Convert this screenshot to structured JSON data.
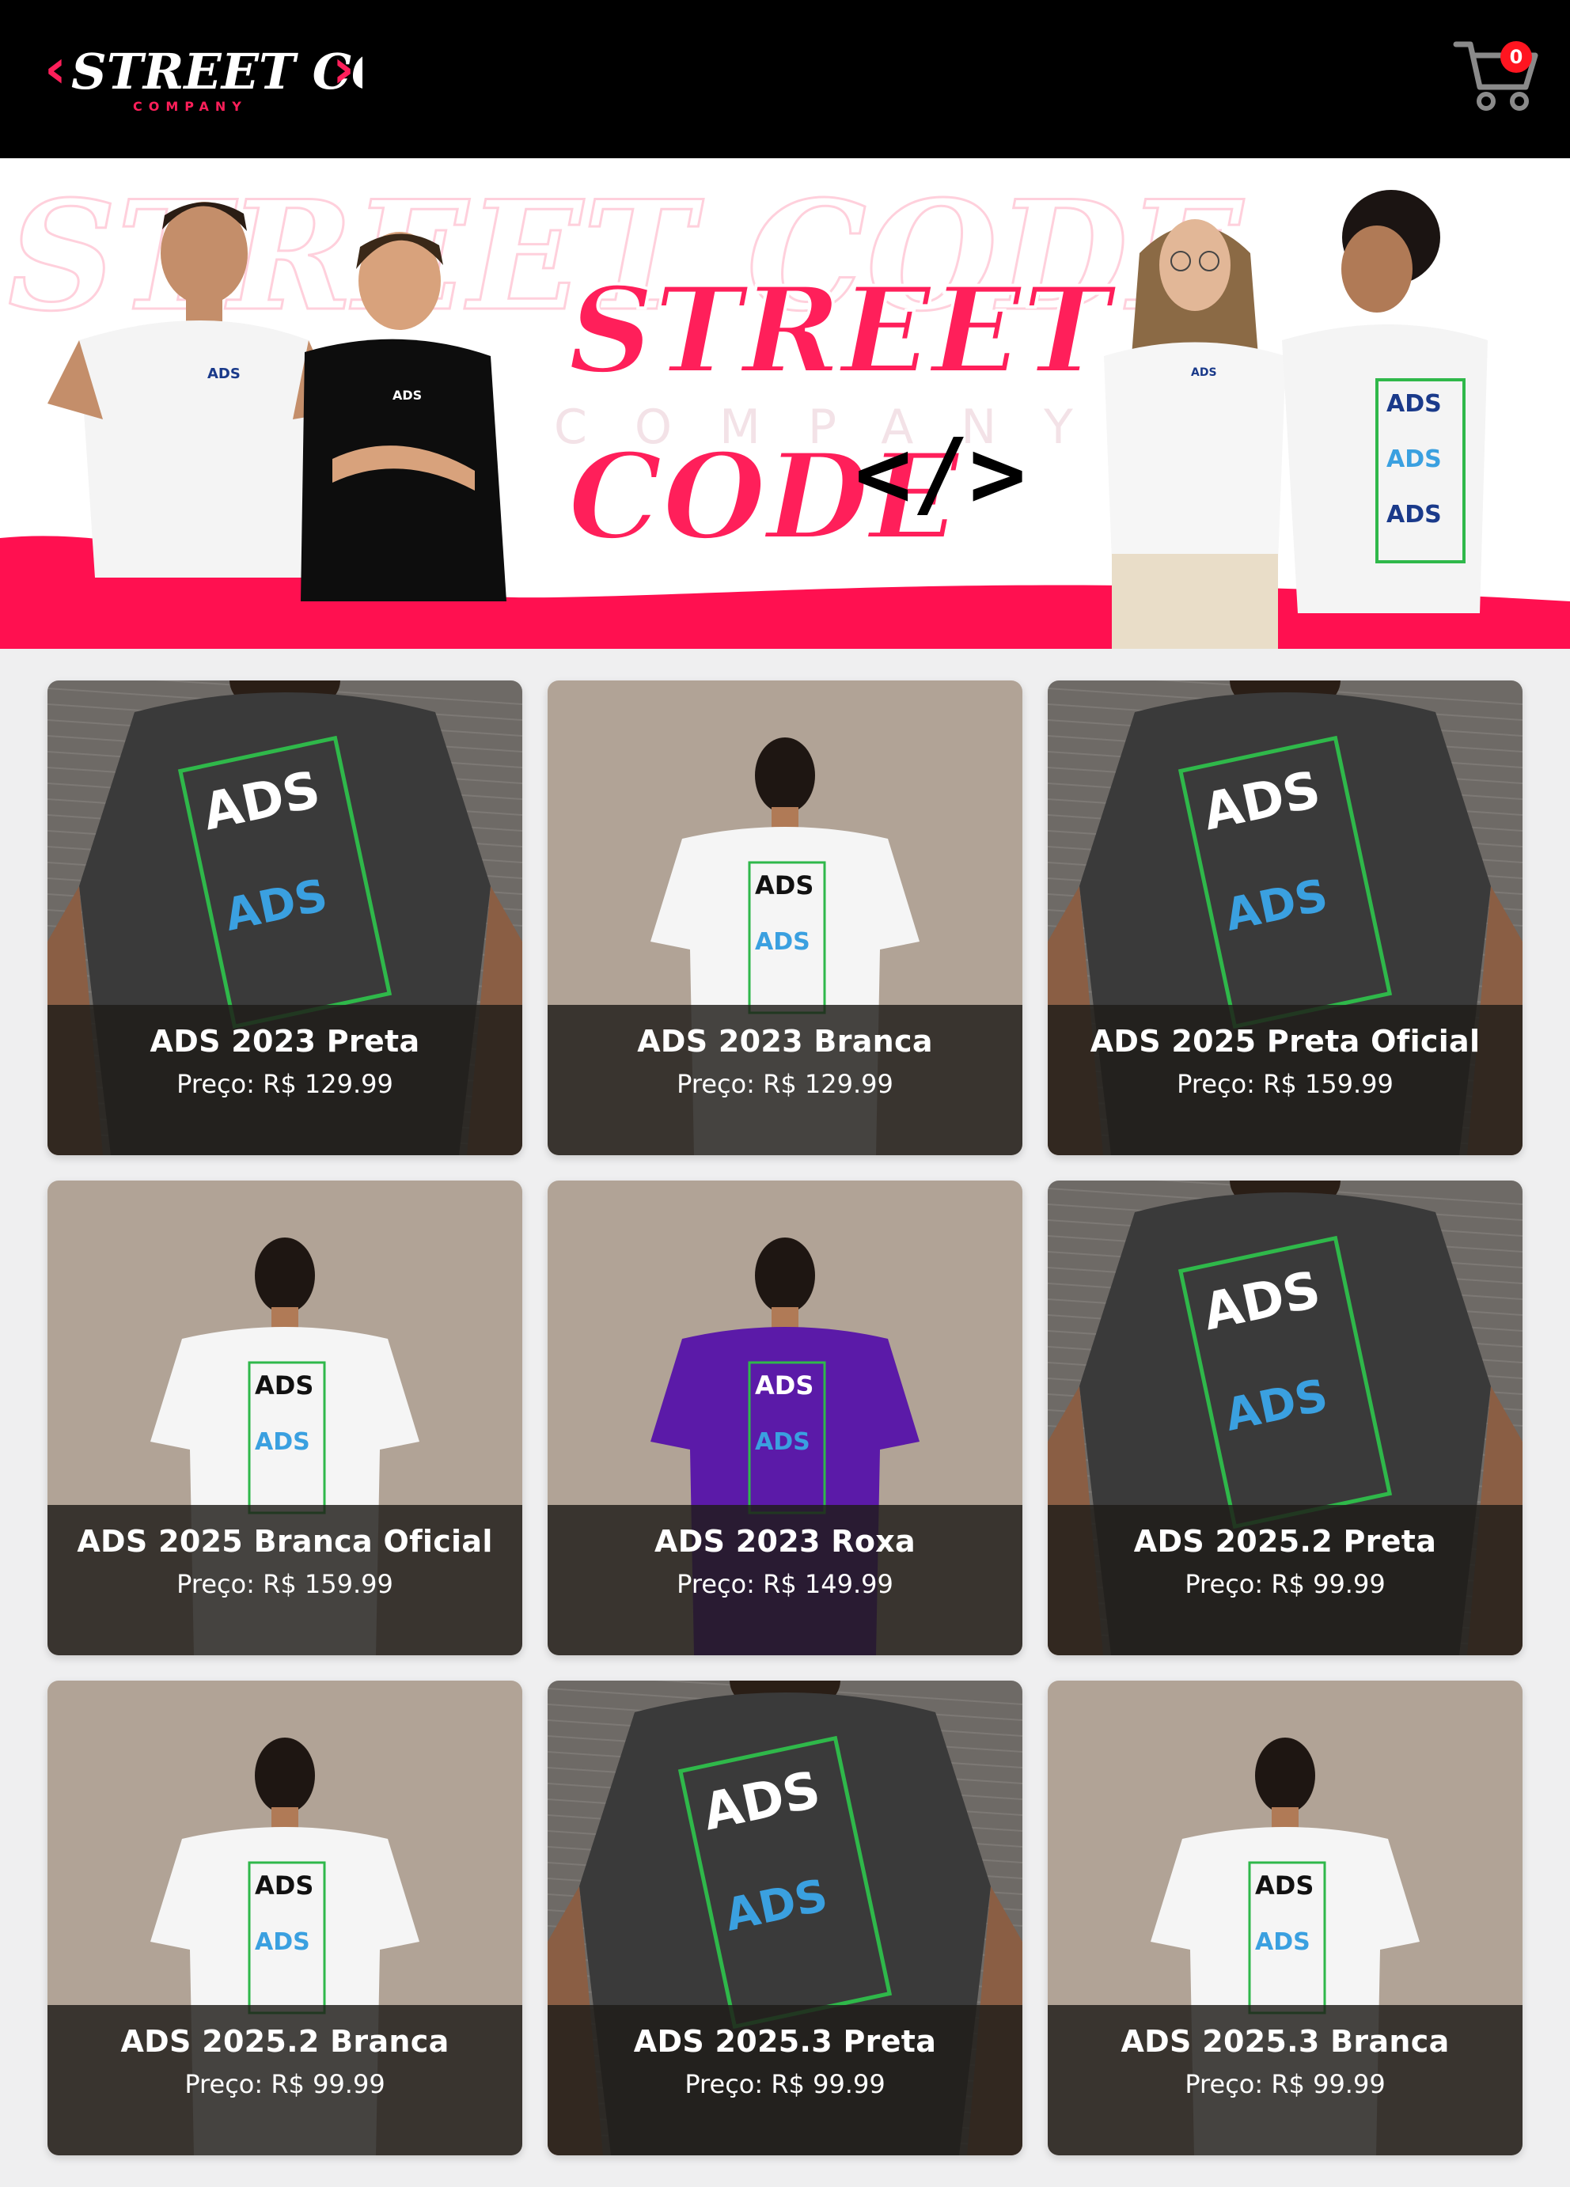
{
  "brand": {
    "logo_text": "STREET CODE",
    "logo_subtext": "COMPANY",
    "accent_color": "#ff1f5a"
  },
  "cart": {
    "icon": "cart-icon",
    "count": "0"
  },
  "banner": {
    "headline_line1": "STREET",
    "headline_line2": "CODE",
    "code_symbol": "</>",
    "watermark": "STREET CODE",
    "watermark_sub": "COMPANY",
    "shirt_badge": "ADS"
  },
  "products": [
    {
      "title": "ADS 2023 Preta",
      "price": "Preço: R$ 129.99",
      "shirt_color": "#3a3a3a",
      "backdrop": "brick"
    },
    {
      "title": "ADS 2023 Branca",
      "price": "Preço: R$ 129.99",
      "shirt_color": "#f5f5f5",
      "backdrop": "beige"
    },
    {
      "title": "ADS 2025 Preta Oficial",
      "price": "Preço: R$ 159.99",
      "shirt_color": "#3a3a3a",
      "backdrop": "brick"
    },
    {
      "title": "ADS 2025 Branca Oficial",
      "price": "Preço: R$ 159.99",
      "shirt_color": "#f5f5f5",
      "backdrop": "beige"
    },
    {
      "title": "ADS 2023 Roxa",
      "price": "Preço: R$ 149.99",
      "shirt_color": "#5b1aa8",
      "backdrop": "beige"
    },
    {
      "title": "ADS 2025.2 Preta",
      "price": "Preço: R$ 99.99",
      "shirt_color": "#3a3a3a",
      "backdrop": "brick"
    },
    {
      "title": "ADS 2025.2 Branca",
      "price": "Preço: R$ 99.99",
      "shirt_color": "#f5f5f5",
      "backdrop": "beige"
    },
    {
      "title": "ADS 2025.3 Preta",
      "price": "Preço: R$ 99.99",
      "shirt_color": "#3a3a3a",
      "backdrop": "brick"
    },
    {
      "title": "ADS 2025.3 Branca",
      "price": "Preço: R$ 99.99",
      "shirt_color": "#f5f5f5",
      "backdrop": "beige"
    }
  ],
  "print_text": "ADS"
}
